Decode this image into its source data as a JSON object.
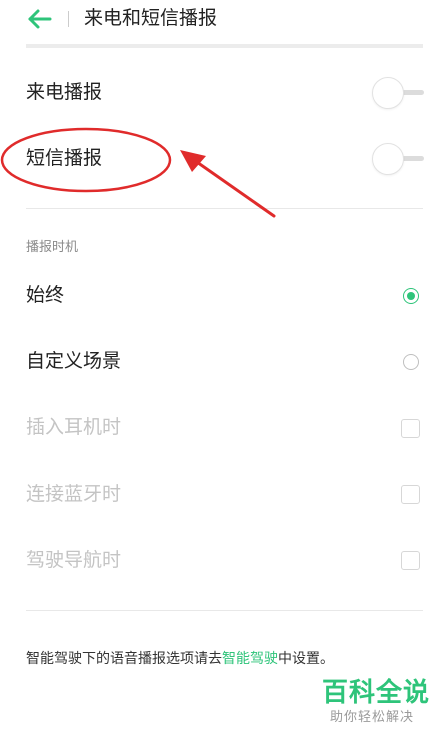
{
  "header": {
    "title": "来电和短信播报",
    "back_icon": "arrow-left-icon",
    "accent": "#2ec47a"
  },
  "toggles": [
    {
      "label": "来电播报",
      "on": false
    },
    {
      "label": "短信播报",
      "on": false
    }
  ],
  "section": {
    "title": "播报时机"
  },
  "radio_options": [
    {
      "label": "始终",
      "selected": true
    },
    {
      "label": "自定义场景",
      "selected": false
    }
  ],
  "custom_scenes": [
    {
      "label": "插入耳机时",
      "checked": false,
      "disabled": true
    },
    {
      "label": "连接蓝牙时",
      "checked": false,
      "disabled": true
    },
    {
      "label": "驾驶导航时",
      "checked": false,
      "disabled": true
    }
  ],
  "footer": {
    "prefix": "智能驾驶下的语音播报选项请去",
    "link": "智能驾驶",
    "suffix": "中设置。"
  },
  "annotation": {
    "color": "#e02b2b"
  },
  "watermark": {
    "title": "百科全说",
    "subtitle": "助你轻松解决"
  }
}
